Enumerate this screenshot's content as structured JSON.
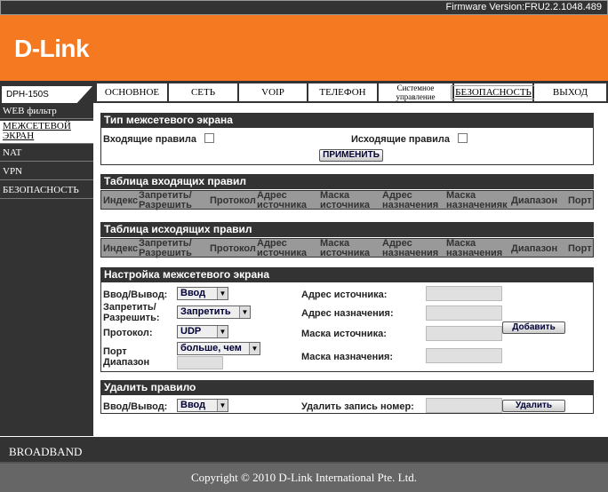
{
  "firmware": "Firmware Version:FRU2.2.1048.489",
  "brand": "D-Link",
  "model": "DPH-150S",
  "tabs": {
    "basic": "ОСНОВНОЕ",
    "network": "СЕТЬ",
    "voip": "VOIP",
    "phone": "ТЕЛЕФОН",
    "system": "Системное управление",
    "security": "БЕЗОПАСНОСТЬ",
    "logout": "ВЫХОД"
  },
  "sidebar": {
    "web_filter": "WEB фильтр",
    "firewall": "МЕЖСЕТЕВОЙ ЭКРАН",
    "nat": "NAT",
    "vpn": "VPN",
    "security": "БЕЗОПАСНОСТЬ"
  },
  "firewall_type": {
    "title": "Тип межсетевого экрана",
    "incoming": "Входящие правила",
    "outgoing": "Исходящие правила",
    "apply": "ПРИМЕНИТЬ"
  },
  "incoming_table": {
    "title": "Таблица входящих правил",
    "columns": [
      "Индекс",
      "Запретить/ Разрешить",
      "Протокол",
      "Адрес источника",
      "Маска источника",
      "Адрес назначения",
      "Маска назначенияк",
      "Диапазон",
      "Порт"
    ]
  },
  "outgoing_table": {
    "title": "Таблица исходящих правил",
    "columns": [
      "Индекс",
      "Запретить/ Разрешить",
      "Протокол",
      "Адрес источника",
      "Маска источника",
      "Адрес назначения",
      "Маска назначения",
      "Диапазон",
      "Порт"
    ]
  },
  "settings": {
    "title": "Настройка межсетевого экрана",
    "io_label": "Ввод/Вывод:",
    "io_value": "Ввод",
    "deny_label": "Запретить/ Разрешить:",
    "deny_value": "Запретить",
    "proto_label": "Протокол:",
    "proto_value": "UDP",
    "port_label": "Порт",
    "range_label": "Диапазон",
    "port_value": "больше, чем",
    "src_addr": "Адрес источника:",
    "dst_addr": "Адрес назначения:",
    "src_mask": "Маска источника:",
    "dst_mask": "Маска назначения:",
    "add": "Добавить"
  },
  "delete_rule": {
    "title": "Удалить правило",
    "io_label": "Ввод/Вывод:",
    "io_value": "Ввод",
    "record_label": "Удалить запись номер:",
    "delete": "Удалить"
  },
  "footer": {
    "broadband": "BROADBAND",
    "copyright": "Copyright © 2010 D-Link International Pte. Ltd."
  }
}
